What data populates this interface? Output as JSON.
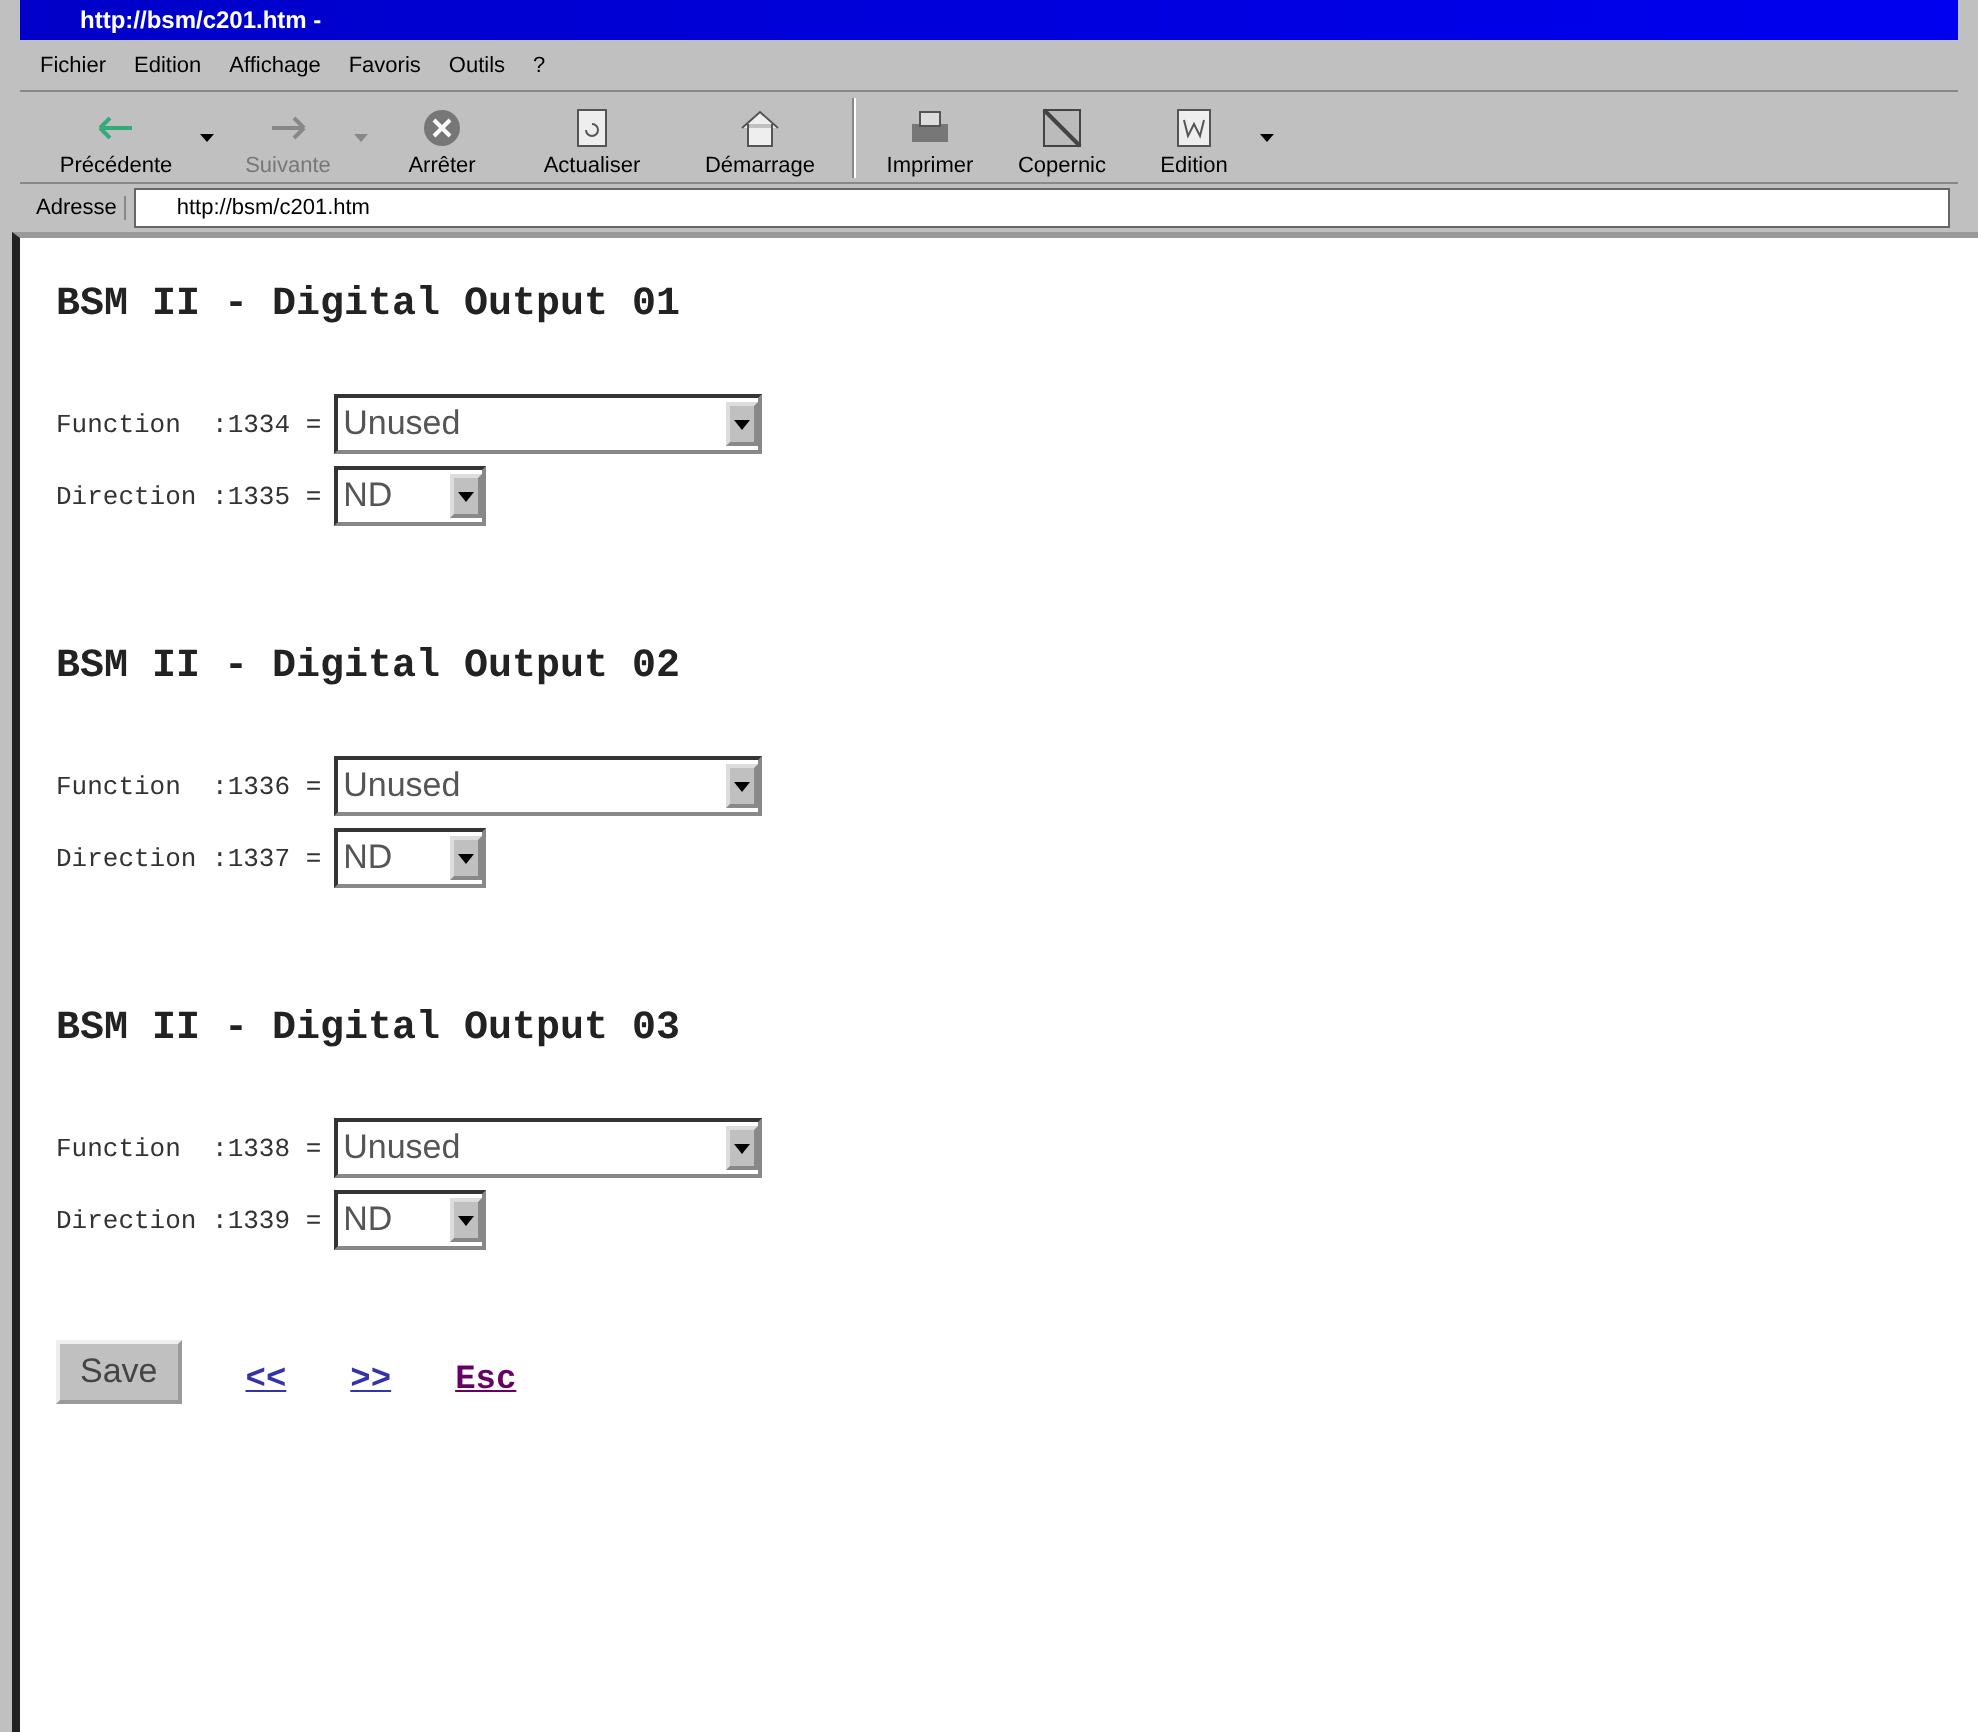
{
  "window": {
    "title": "http://bsm/c201.htm -"
  },
  "menu": [
    "Fichier",
    "Edition",
    "Affichage",
    "Favoris",
    "Outils",
    "?"
  ],
  "toolbar": [
    {
      "label": "Précédente",
      "disabled": false,
      "dropdown": true
    },
    {
      "label": "Suivante",
      "disabled": true,
      "dropdown": true
    },
    {
      "label": "Arrêter",
      "disabled": false,
      "dropdown": false
    },
    {
      "label": "Actualiser",
      "disabled": false,
      "dropdown": false
    },
    {
      "label": "Démarrage",
      "disabled": false,
      "dropdown": false
    },
    {
      "label": "Imprimer",
      "disabled": false,
      "dropdown": false,
      "separator": true
    },
    {
      "label": "Copernic",
      "disabled": false,
      "dropdown": false
    },
    {
      "label": "Edition",
      "disabled": false,
      "dropdown": true
    }
  ],
  "address": {
    "label": "Adresse",
    "value": "http://bsm/c201.htm"
  },
  "sections": [
    {
      "heading": "BSM II - Digital Output 01",
      "fields": [
        {
          "label": "Function  :1334 =",
          "value": "Unused",
          "kind": "wide"
        },
        {
          "label": "Direction :1335 =",
          "value": "ND",
          "kind": "narrow"
        }
      ]
    },
    {
      "heading": "BSM II - Digital Output 02",
      "fields": [
        {
          "label": "Function  :1336 =",
          "value": "Unused",
          "kind": "wide"
        },
        {
          "label": "Direction :1337 =",
          "value": "ND",
          "kind": "narrow"
        }
      ]
    },
    {
      "heading": "BSM II - Digital Output 03",
      "fields": [
        {
          "label": "Function  :1338 =",
          "value": "Unused",
          "kind": "wide"
        },
        {
          "label": "Direction :1339 =",
          "value": "ND",
          "kind": "narrow"
        }
      ]
    }
  ],
  "save": "Save",
  "links": [
    {
      "label": "<<",
      "visited": false
    },
    {
      "label": ">>",
      "visited": false
    },
    {
      "label": "Esc",
      "visited": true
    }
  ]
}
